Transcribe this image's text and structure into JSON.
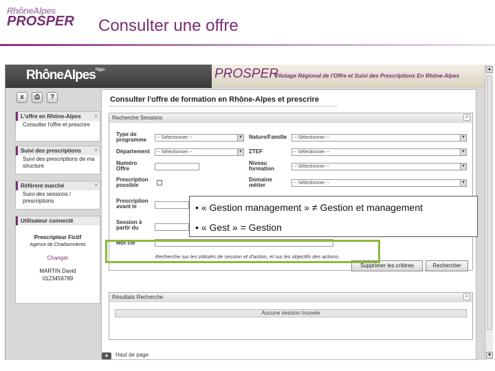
{
  "slide": {
    "logo_top": "RhôneAlpes",
    "logo_bottom": "PROSPER",
    "title": "Consulter une offre"
  },
  "banner": {
    "region": "RhôneAlpes",
    "region_small": "Région",
    "app": "PROSPER",
    "subtitle": "Pilotage Régional de l'Offre et Suivi des Prescriptions En Rhône-Alpes"
  },
  "toolbar": {
    "close": "x",
    "print": "⎙",
    "help": "?"
  },
  "sidebar": {
    "offre_header": "L'offre en Rhône-Alpes",
    "offre_items": [
      "Consulter l'offre et prescrire"
    ],
    "suivi_header": "Suivi des prescriptions",
    "suivi_items": [
      "Suivi des prescriptions de ma structure"
    ],
    "ref_header": "Référent marché",
    "ref_items": [
      "Suivi des sessions / prescriptions"
    ],
    "user_header": "Utilisateur connecté",
    "user_name": "Prescripteur Fictif",
    "user_agency": "Agence de Charbonnières",
    "change": "Changer",
    "contact_name": "MARTIN David",
    "contact_phone": "0123456789",
    "close_mark": "×"
  },
  "main": {
    "page_title": "Consulter l'offre de formation en Rhône-Alpes et prescrire",
    "search_panel_title": "Recherche Sessions",
    "labels": {
      "type": "Type de programme",
      "nature": "Nature/Famille",
      "departement": "Département",
      "ztef": "ZTEF",
      "numero": "Numéro Offre",
      "niveau": "Niveau formation",
      "prescription_possible": "Prescription possible",
      "domaine": "Domaine métier",
      "prescription_avant": "Prescription avant le",
      "session": "Session à partir du",
      "motcle": "Mot clé"
    },
    "select_default": "-- Sélectionner --",
    "keyword_note": "Recherche sur les intitulés de session et d'action, et sur les objectifs des actions.",
    "btn_clear": "Supprimer les critères",
    "btn_search": "Rechercher",
    "results_title": "Résultats Recherche",
    "no_result": "Aucune session trouvée",
    "back_top": "Haut de page"
  },
  "callout": {
    "line1": "• « Gestion management » ≠ Gestion et management",
    "line2": "• « Gest » = Gestion"
  }
}
